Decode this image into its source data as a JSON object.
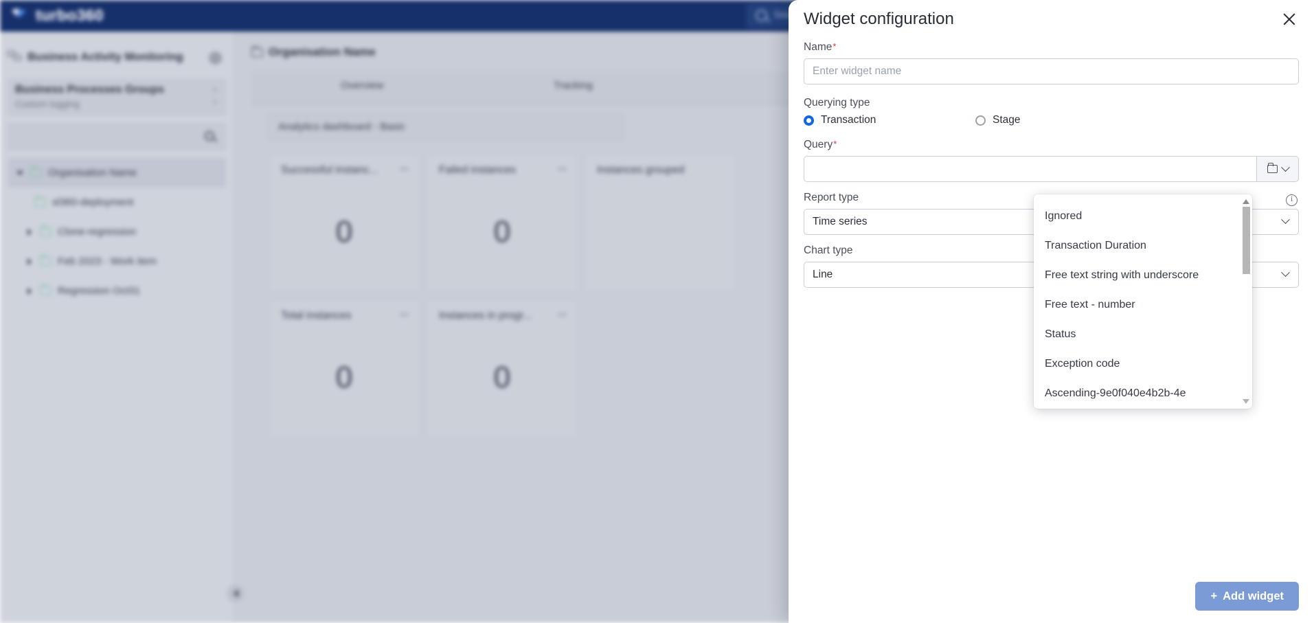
{
  "app": {
    "brand": "turbo360",
    "search_placeholder": "Search"
  },
  "sidebar": {
    "section_title": "Business Activity Monitoring",
    "group": {
      "title": "Business Processes Groups",
      "subtitle": "Custom logging"
    },
    "search_placeholder": "",
    "tree": [
      {
        "label": "Organisation Name",
        "caret": "down",
        "selected": true,
        "depth": 0
      },
      {
        "label": "sl360-deployment",
        "caret": "none",
        "selected": false,
        "depth": 1
      },
      {
        "label": "Clone-regression",
        "caret": "right",
        "selected": false,
        "depth": 1
      },
      {
        "label": "Feb 2023 - Work item",
        "caret": "right",
        "selected": false,
        "depth": 1
      },
      {
        "label": "Regression Oct31",
        "caret": "right",
        "selected": false,
        "depth": 1
      }
    ]
  },
  "main": {
    "breadcrumb": "Organisation Name",
    "tabs": [
      {
        "label": "Overview",
        "active": true
      },
      {
        "label": "Tracking",
        "active": false
      }
    ],
    "dashboard_name": "Analytics dashboard - Basic",
    "cards": [
      {
        "title": "Successful instanc...",
        "value": "0"
      },
      {
        "title": "Failed instances",
        "value": "0"
      },
      {
        "title": "Instances grouped",
        "value": ""
      },
      {
        "title": "Total instances",
        "value": "0"
      },
      {
        "title": "Instances in progr...",
        "value": "0"
      }
    ]
  },
  "drawer": {
    "title": "Widget configuration",
    "close_label": "×",
    "fields": {
      "name": {
        "label": "Name",
        "required": true,
        "value": "",
        "placeholder": "Enter widget name"
      },
      "querying_type": {
        "label": "Querying type",
        "options": [
          {
            "label": "Transaction",
            "selected": true
          },
          {
            "label": "Stage",
            "selected": false
          }
        ]
      },
      "query": {
        "label": "Query",
        "required": true,
        "value": "",
        "placeholder": ""
      },
      "report_type": {
        "label": "Report type",
        "value": "Time series"
      },
      "chart_type": {
        "label": "Chart type",
        "value": "Line"
      }
    },
    "dropdown": {
      "items": [
        "Ignored",
        "Transaction Duration",
        "Free text string with underscore",
        "Free text - number",
        "Status",
        "Exception code",
        "Ascending-9e0f040e4b2b-4e"
      ]
    },
    "footer": {
      "add_widget_label": "Add widget",
      "add_widget_plus": "+"
    }
  },
  "colors": {
    "brand_navy": "#16306b",
    "accent_blue": "#1565e0",
    "button_blue": "#7b9bd6",
    "required_red": "#e03131"
  }
}
